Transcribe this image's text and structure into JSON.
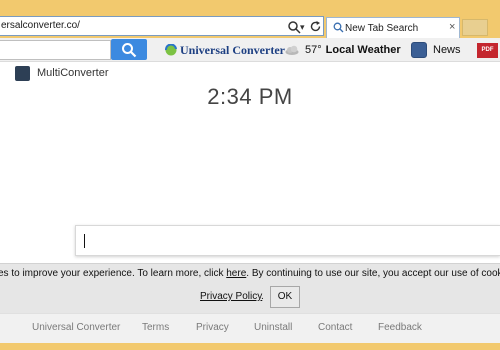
{
  "browser": {
    "address": "ersalconverter.co/",
    "tab_title": "New Tab Search",
    "tab_close": "×",
    "dropdown_glyph": "▾"
  },
  "toolbar": {
    "search_icon": "search-icon",
    "universal_converter_label": "Universal Converter",
    "weather_temp": "57°",
    "weather_label": "Local Weather",
    "news_label": "News",
    "pdf_label": "PDF"
  },
  "page": {
    "brand_label": "MultiConverter",
    "clock": "2:34 PM",
    "search_value": ""
  },
  "cookie": {
    "text_before_link": "es to improve your experience. To learn more, click ",
    "link_text": "here",
    "text_after_link": ". By continuing to use our site, you accept our use of cookie",
    "privacy_link": "Privacy Policy",
    "privacy_period": ".",
    "ok_label": "OK"
  },
  "footer": {
    "links": [
      "Universal Converter",
      "Terms",
      "Privacy",
      "Uninstall",
      "Contact",
      "Feedback"
    ]
  },
  "colors": {
    "browser_frame": "#f2c96e",
    "search_button": "#3c8ae0",
    "brand_text": "#1d3f82"
  }
}
